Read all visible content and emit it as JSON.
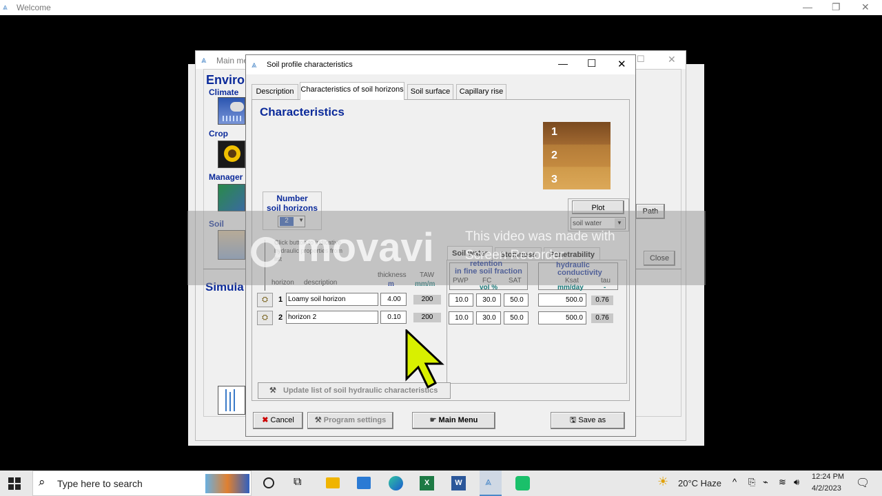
{
  "window": {
    "title": "Welcome",
    "minimize": "—",
    "restore": "❐",
    "close": "✕"
  },
  "main_window": {
    "title": "Main me",
    "section_environment": "Enviro",
    "climate": "Climate",
    "crop": "Crop",
    "management": "Manager",
    "soil": "Soil",
    "simulation": "Simula",
    "path_button": "Path",
    "close_button": "Close"
  },
  "dialog": {
    "title": "Soil profile characteristics",
    "tabs": [
      "Description",
      "Characteristics of soil horizons",
      "Soil surface",
      "Capillary rise"
    ],
    "heading": "Characteristics",
    "layer_labels": [
      "1",
      "2",
      "3"
    ],
    "plot_button": "Plot",
    "plot_select": "soil water",
    "number_horizons_label_1": "Number",
    "number_horizons_label_2": "soil horizons",
    "number_horizons_value": "2",
    "hint_text": "Click button to indicative hydraulic properties from list",
    "subtabs": [
      "Soil water",
      "Stoniness",
      "Penetrability"
    ],
    "headers": {
      "horizon": "horizon",
      "description": "description",
      "thickness": "thickness",
      "thickness_unit": "m",
      "taw": "TAW",
      "taw_unit": "mm/m",
      "retention_1": "retention",
      "retention_2": "in fine soil fraction",
      "pwp": "PWP",
      "fc": "FC",
      "sat": "SAT",
      "vol_unit": "vol %",
      "hydraulic_1": "hydraulic",
      "hydraulic_2": "conductivity",
      "ksat": "Ksat",
      "ksat_unit": "mm/day",
      "tau": "tau",
      "tau_unit": "-"
    },
    "rows": [
      {
        "num": "1",
        "description": "Loamy soil horizon",
        "thickness": "4.00",
        "taw": "200",
        "pwp": "10.0",
        "fc": "30.0",
        "sat": "50.0",
        "ksat": "500.0",
        "tau": "0.76"
      },
      {
        "num": "2",
        "description": "horizon 2",
        "thickness": "0.10",
        "taw": "200",
        "pwp": "10.0",
        "fc": "30.0",
        "sat": "50.0",
        "ksat": "500.0",
        "tau": "0.76"
      }
    ],
    "update_button": "Update list of soil hydraulic characteristics",
    "cancel_button": "Cancel",
    "program_settings_button": "Program settings",
    "main_menu_button": "Main Menu",
    "save_as_button": "Save as"
  },
  "watermark": {
    "brand": "movavi",
    "line1": "This video was made with",
    "line2": "Screen Recorder"
  },
  "taskbar": {
    "search_placeholder": "Type here to search",
    "weather": "20°C  Haze",
    "time": "12:24 PM",
    "date": "4/2/2023"
  }
}
